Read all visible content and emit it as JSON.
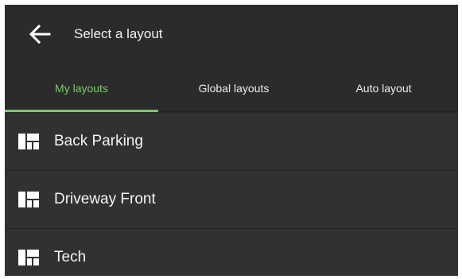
{
  "app_bar": {
    "back_icon": "arrow-left-icon",
    "title": "Select a layout"
  },
  "tabs": [
    {
      "label": "My layouts",
      "active": true
    },
    {
      "label": "Global layouts",
      "active": false
    },
    {
      "label": "Auto layout",
      "active": false
    }
  ],
  "layouts": [
    {
      "icon": "layout-grid-icon",
      "label": "Back Parking"
    },
    {
      "icon": "layout-grid-icon",
      "label": "Driveway Front"
    },
    {
      "icon": "layout-grid-icon",
      "label": "Tech"
    }
  ],
  "colors": {
    "background": "#2b2b2b",
    "list_background": "#313131",
    "accent": "#7cc86b",
    "text": "#f2f2f2"
  }
}
